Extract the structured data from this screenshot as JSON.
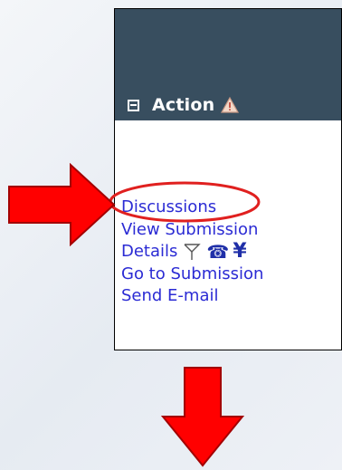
{
  "panel": {
    "header_title": "Action",
    "collapse_icon": "collapse-square-icon",
    "header_icon": "warning-triangle-icon"
  },
  "links": {
    "discussions": "Discussions",
    "view_submission": "View Submission",
    "details": "Details",
    "go_to_submission": "Go to Submission",
    "send_email": "Send E-mail"
  },
  "details_icons": [
    "flag-outline-icon",
    "telephone-icon",
    "yen-icon"
  ],
  "icon_glyphs": {
    "telephone": "☎",
    "yen": "¥"
  },
  "annotations": {
    "arrow_color": "#ff0000",
    "highlight_color": "#e0201f"
  },
  "colors": {
    "header_bg": "#384e5f",
    "link": "#2b2bd4"
  }
}
